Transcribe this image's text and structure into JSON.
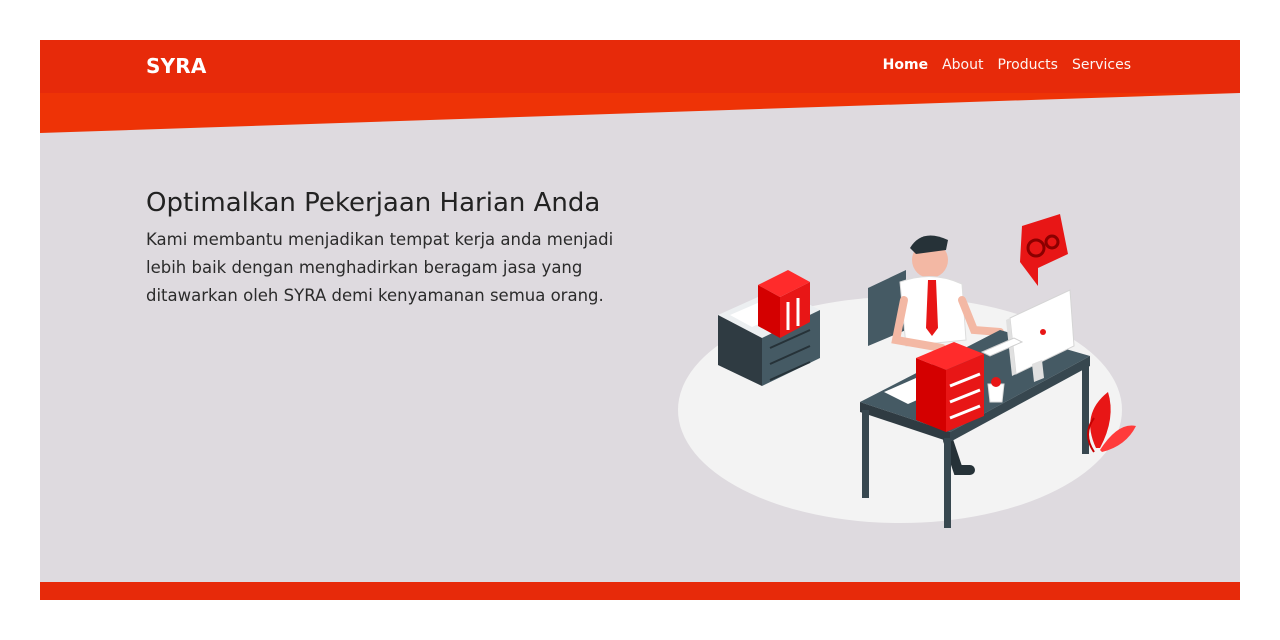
{
  "brand": {
    "name": "SYRA"
  },
  "nav": {
    "items": [
      {
        "label": "Home",
        "active": true
      },
      {
        "label": "About",
        "active": false
      },
      {
        "label": "Products",
        "active": false
      },
      {
        "label": "Services",
        "active": false
      }
    ]
  },
  "hero": {
    "title": "Optimalkan Pekerjaan Harian Anda",
    "description": "Kami membantu menjadikan tempat kerja anda menjadi lebih baik dengan menghadirkan beragam jasa yang ditawarkan oleh SYRA demi kenyamanan semua orang."
  },
  "colors": {
    "primary": "#e72a0a",
    "hero_bg": "#dedadf"
  }
}
